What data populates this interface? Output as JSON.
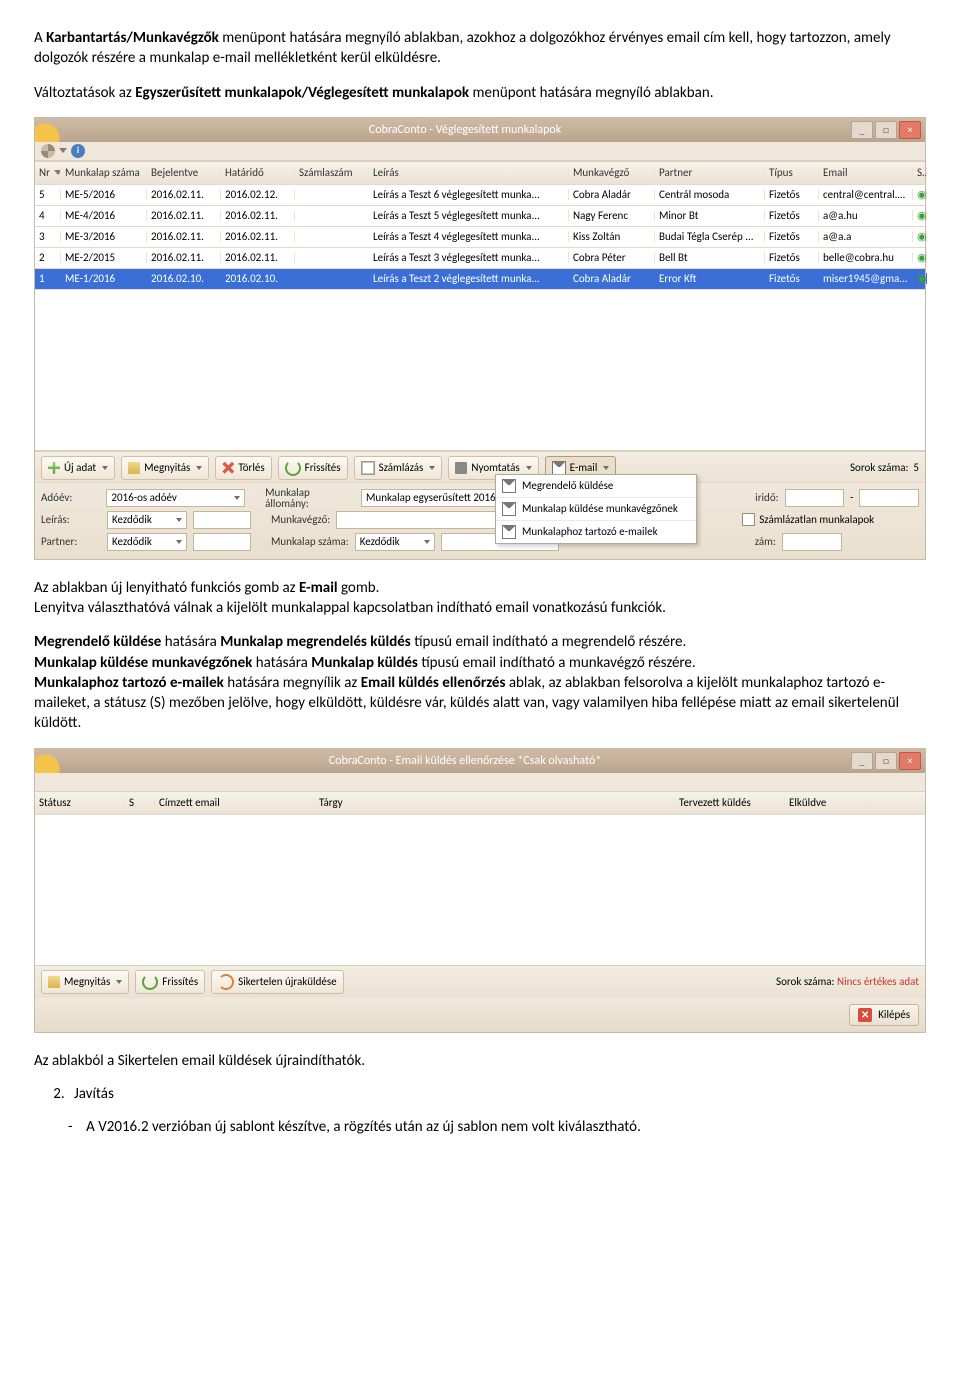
{
  "para1_a": "A ",
  "para1_b": "Karbantartás/Munkavégzők",
  "para1_c": " menüpont hatására megnyíló ablakban, azokhoz a dolgozókhoz érvényes email cím kell, hogy tartozzon, amely dolgozók részére a munkalap e-mail mellékletként kerül elküldésre.",
  "para2_a": "Változtatások az ",
  "para2_b": "Egyszerűsített munkalapok/Véglegesített munkalapok",
  "para2_c": " menüpont hatására megnyíló ablakban.",
  "win1": {
    "title": "CobraConto - Véglegesített munkalapok",
    "cols": [
      "Nr",
      "Munkalap száma",
      "Bejelentve",
      "Határidő",
      "Számlaszám",
      "Leírás",
      "Munkavégző",
      "Partner",
      "Típus",
      "Email",
      "S"
    ],
    "rows": [
      {
        "nr": "5",
        "ms": "ME-5/2016",
        "be": "2016.02.11.",
        "ha": "2016.02.12.",
        "sz": "",
        "le": "Leírás a Teszt 6 véglegesített munka...",
        "mv": "Cobra Aladár",
        "pa": "Centrál mosoda",
        "ti": "Fizetős",
        "em": "central@central.hu"
      },
      {
        "nr": "4",
        "ms": "ME-4/2016",
        "be": "2016.02.11.",
        "ha": "2016.02.11.",
        "sz": "",
        "le": "Leírás a Teszt 5 véglegesített munka...",
        "mv": "Nagy Ferenc",
        "pa": "Minor Bt",
        "ti": "Fizetős",
        "em": "a@a.hu"
      },
      {
        "nr": "3",
        "ms": "ME-3/2016",
        "be": "2016.02.11.",
        "ha": "2016.02.11.",
        "sz": "",
        "le": "Leírás a Teszt 4 véglegesített munka...",
        "mv": "Kiss Zoltán",
        "pa": "Budai Tégla Cserép ...",
        "ti": "Fizetős",
        "em": "a@a.a"
      },
      {
        "nr": "2",
        "ms": "ME-2/2015",
        "be": "2016.02.11.",
        "ha": "2016.02.11.",
        "sz": "",
        "le": "Leírás a Teszt 3 véglegesített munka...",
        "mv": "Cobra Péter",
        "pa": "Bell Bt",
        "ti": "Fizetős",
        "em": "belle@cobra.hu"
      },
      {
        "nr": "1",
        "ms": "ME-1/2016",
        "be": "2016.02.10.",
        "ha": "2016.02.10.",
        "sz": "",
        "le": "Leírás a Teszt 2 véglegesített munka...",
        "mv": "Cobra Aladár",
        "pa": "Error Kft",
        "ti": "Fizetős",
        "em": "miser1945@gma..."
      }
    ],
    "toolbar": {
      "new": "Új adat",
      "open": "Megnyitás",
      "del": "Törlés",
      "refresh": "Frissítés",
      "invoice": "Számlázás",
      "print": "Nyomtatás",
      "email": "E-mail",
      "rows_label": "Sorok száma:",
      "rows_val": "5"
    },
    "popup": {
      "i1": "Megrendelő küldése",
      "i2": "Munkalap küldése munkavégzőnek",
      "i3": "Munkalaphoz tartozó e-mailek"
    },
    "filters": {
      "adoev_l": "Adóév:",
      "adoev_v": "2016-os adóév",
      "allomany_l": "Munkalap állomány:",
      "allomany_v": "Munkalap egyserűsített 2016",
      "irido_l": "iridő:",
      "dash": "-",
      "leiras_l": "Leírás:",
      "kezd": "Kezdődik",
      "munkavegzo_l": "Munkavégző:",
      "szamlazatlan": "Számlázatlan munkalapok",
      "partner_l": "Partner:",
      "szam_l": "Munkalap száma:",
      "zam_l": "zám:"
    }
  },
  "mid": {
    "l1a": "Az ablakban új lenyitható funkciós gomb az ",
    "l1b": "E-mail",
    "l1c": " gomb.",
    "l2": "Lenyitva választhatóvá válnak a kijelölt munkalappal kapcsolatban indítható email vonatkozású funkciók.",
    "l3a": "Megrendelő küldése",
    "l3b": " hatására ",
    "l3c": "Munkalap megrendelés küldés",
    "l3d": " típusú email indítható a megrendelő részére.",
    "l4a": "Munkalap küldése munkavégzőnek",
    "l4b": " hatására ",
    "l4c": "Munkalap küldés",
    "l4d": " típusú email indítható a munkavégző részére.",
    "l5a": "Munkalaphoz tartozó e-mailek",
    "l5b": " hatására megnyílik az ",
    "l5c": "Email küldés ellenőrzés",
    "l5d": " ablak, az ablakban felsorolva a kijelölt munkalaphoz tartozó e-maileket, a státusz (S) mezőben jelölve, hogy elküldött, küldésre vár, küldés alatt van, vagy valamilyen hiba fellépése miatt az email sikertelenül küldött."
  },
  "win2": {
    "title": "CobraConto - Email küldés ellenőrzése *Csak olvasható*",
    "cols": [
      "Státusz",
      "S",
      "Címzett email",
      "Tárgy",
      "Tervezett küldés",
      "Elküldve"
    ],
    "toolbar": {
      "open": "Megnyitás",
      "refresh": "Frissítés",
      "retry": "Sikertelen újraküldése",
      "rows_label": "Sorok száma:",
      "rows_val": "Nincs értékes adat"
    },
    "exit": "Kilépés"
  },
  "tail": {
    "l1": "Az ablakból a Sikertelen email küldések újraindíthatók.",
    "list2": "Javítás",
    "bullet": "A V2016.2 verzióban új sablont készítve, a rögzítés után az új sablon nem volt kiválasztható."
  }
}
